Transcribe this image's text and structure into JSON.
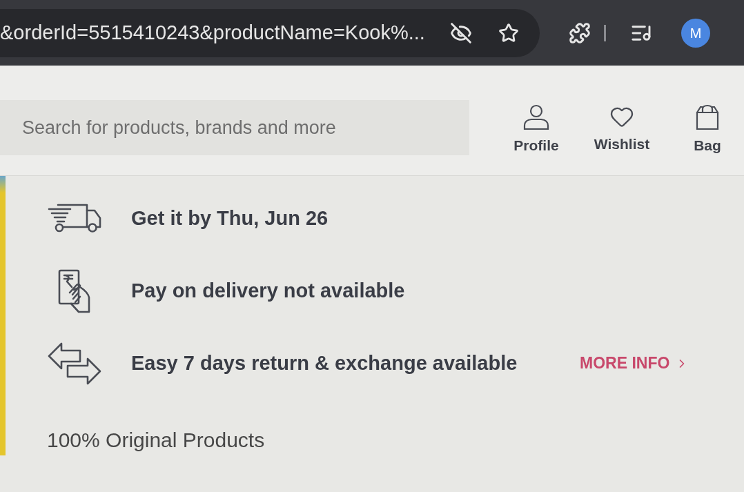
{
  "browser": {
    "url": "&orderId=5515410243&productName=Kook%...",
    "avatar_initial": "M"
  },
  "header": {
    "search": {
      "placeholder": "Search for products, brands and more"
    },
    "actions": [
      {
        "kind": "profile",
        "label": "Profile"
      },
      {
        "kind": "wishlist",
        "label": "Wishlist"
      },
      {
        "kind": "bag",
        "label": "Bag"
      }
    ]
  },
  "delivery_info": [
    {
      "kind": "delivery",
      "text": "Get it by Thu, Jun 26"
    },
    {
      "kind": "payment",
      "text": "Pay on delivery not available"
    },
    {
      "kind": "returns",
      "text": "Easy 7 days return & exchange available",
      "link": "MORE INFO"
    }
  ],
  "note": "100% Original Products"
}
